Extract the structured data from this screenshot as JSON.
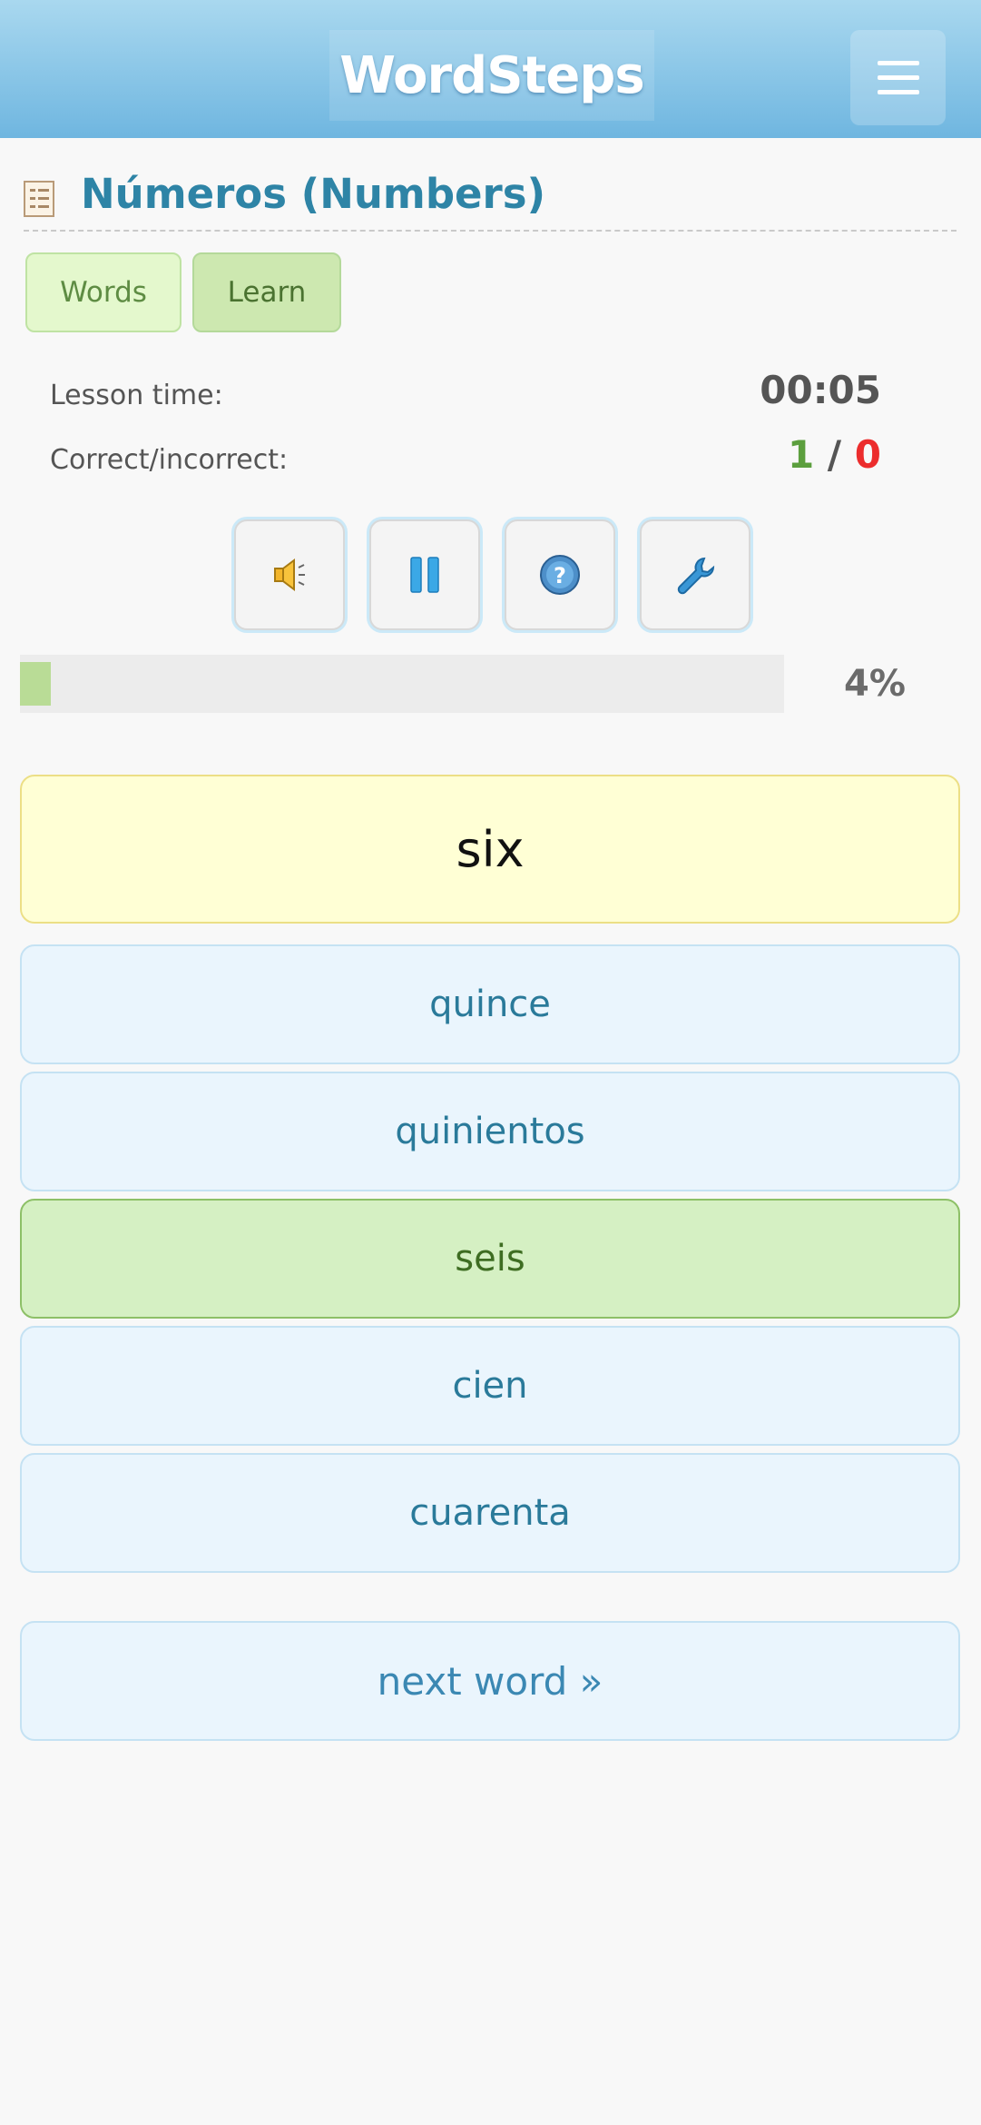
{
  "header": {
    "logo_text": "WordSteps",
    "menu_icon": "hamburger-menu-icon"
  },
  "lesson": {
    "title": "Números (Numbers)",
    "title_icon": "list-icon"
  },
  "tabs": [
    {
      "label": "Words",
      "active": false
    },
    {
      "label": "Learn",
      "active": true
    }
  ],
  "stats": {
    "time_label": "Lesson time:",
    "time_value": "00:05",
    "score_label": "Correct/incorrect:",
    "correct": "1",
    "separator": "/",
    "incorrect": "0"
  },
  "controls": [
    {
      "name": "sound",
      "icon": "speaker-icon"
    },
    {
      "name": "pause",
      "icon": "pause-icon"
    },
    {
      "name": "help",
      "icon": "question-icon"
    },
    {
      "name": "settings",
      "icon": "wrench-icon"
    }
  ],
  "progress": {
    "value": 0.04,
    "label": "4%"
  },
  "quiz": {
    "prompt": "six",
    "answers": [
      {
        "text": "quince",
        "state": "normal"
      },
      {
        "text": "quinientos",
        "state": "normal"
      },
      {
        "text": "seis",
        "state": "correct"
      },
      {
        "text": "cien",
        "state": "normal"
      },
      {
        "text": "cuarenta",
        "state": "normal"
      }
    ],
    "next_label": "next word »"
  },
  "colors": {
    "header_top": "#a9d8ef",
    "header_bottom": "#6fb6e0",
    "title": "#2e84a6",
    "correct": "#5c9f3e",
    "incorrect": "#ec2d2d",
    "prompt_bg": "#ffffd5",
    "answer_bg": "#eaf5fd",
    "correct_answer_bg": "#d5f0c3"
  }
}
